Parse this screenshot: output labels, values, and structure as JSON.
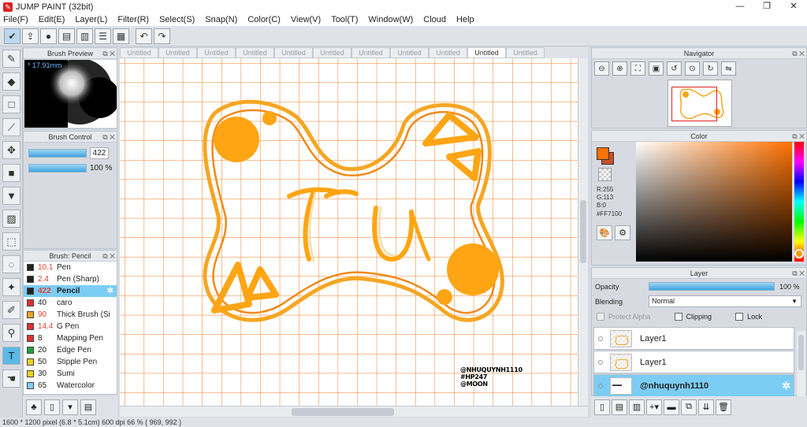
{
  "window": {
    "title": "JUMP PAINT (32bit)",
    "controls": [
      "—",
      "❐",
      "✕"
    ]
  },
  "menu": [
    "File(F)",
    "Edit(E)",
    "Layer(L)",
    "Filter(R)",
    "Select(S)",
    "Snap(N)",
    "Color(C)",
    "View(V)",
    "Tool(T)",
    "Window(W)",
    "Cloud",
    "Help"
  ],
  "tabs": [
    {
      "label": "Untitled",
      "active": false
    },
    {
      "label": "Untitled",
      "active": false
    },
    {
      "label": "Untitled",
      "active": false
    },
    {
      "label": "Untitled",
      "active": false
    },
    {
      "label": "Untitled",
      "active": false
    },
    {
      "label": "Untitled",
      "active": false
    },
    {
      "label": "Untitled",
      "active": false
    },
    {
      "label": "Untitled",
      "active": false
    },
    {
      "label": "Untitled",
      "active": false
    },
    {
      "label": "Untitled",
      "active": true
    },
    {
      "label": "Untitled",
      "active": false
    }
  ],
  "brush_preview": {
    "title": "Brush Preview",
    "size": "* 17.91mm"
  },
  "brush_control": {
    "title": "Brush Control",
    "size_value": "422",
    "opacity_value": "100 %"
  },
  "brush_list": {
    "title": "Brush: Pencil",
    "items": [
      {
        "num": "10.1",
        "name": "Pen",
        "color": "#222222",
        "red": true,
        "selected": false
      },
      {
        "num": "2.4",
        "name": "Pen (Sharp)",
        "color": "#222222",
        "red": true,
        "selected": false
      },
      {
        "num": "422",
        "name": "Pencil",
        "color": "#222222",
        "red": true,
        "selected": true
      },
      {
        "num": "40",
        "name": "caro",
        "color": "#e03030",
        "red": false,
        "selected": false
      },
      {
        "num": "90",
        "name": "Thick Brush (Si",
        "color": "#f0a020",
        "red": true,
        "selected": false
      },
      {
        "num": "14.4",
        "name": "G Pen",
        "color": "#e03030",
        "red": true,
        "selected": false
      },
      {
        "num": "8",
        "name": "Mapping Pen",
        "color": "#e03030",
        "red": false,
        "selected": false
      },
      {
        "num": "20",
        "name": "Edge Pen",
        "color": "#20a040",
        "red": false,
        "selected": false
      },
      {
        "num": "50",
        "name": "Stipple Pen",
        "color": "#f0d020",
        "red": false,
        "selected": false
      },
      {
        "num": "30",
        "name": "Sumi",
        "color": "#f0d020",
        "red": false,
        "selected": false
      },
      {
        "num": "65",
        "name": "Watercolor",
        "color": "#80d0f0",
        "red": false,
        "selected": false
      }
    ]
  },
  "canvas": {
    "signature": [
      "@NHUQUYNH1110",
      "#HP247",
      "@MOON"
    ],
    "accent": "#FFA500",
    "grid": "#F07A20"
  },
  "navigator": {
    "title": "Navigator"
  },
  "color": {
    "title": "Color",
    "fg": "#FF7100",
    "rgb": [
      "R:255",
      "G:113",
      "B:0"
    ],
    "hex": "#FF7100"
  },
  "layer_panel": {
    "title": "Layer",
    "opacity_label": "Opacity",
    "opacity_value": "100 %",
    "blending_label": "Blending",
    "blending_value": "Normal",
    "protect_alpha": "Protect Alpha",
    "clipping": "Clipping",
    "lock": "Lock",
    "layers": [
      {
        "name": "Layer1",
        "selected": false
      },
      {
        "name": "Layer1",
        "selected": false
      },
      {
        "name": "@nhuquynh1110",
        "selected": true
      }
    ]
  },
  "status": "1600 * 1200 pixel  (6.8 * 5.1cm)  600 dpi  66 %  ( 969, 992 )"
}
